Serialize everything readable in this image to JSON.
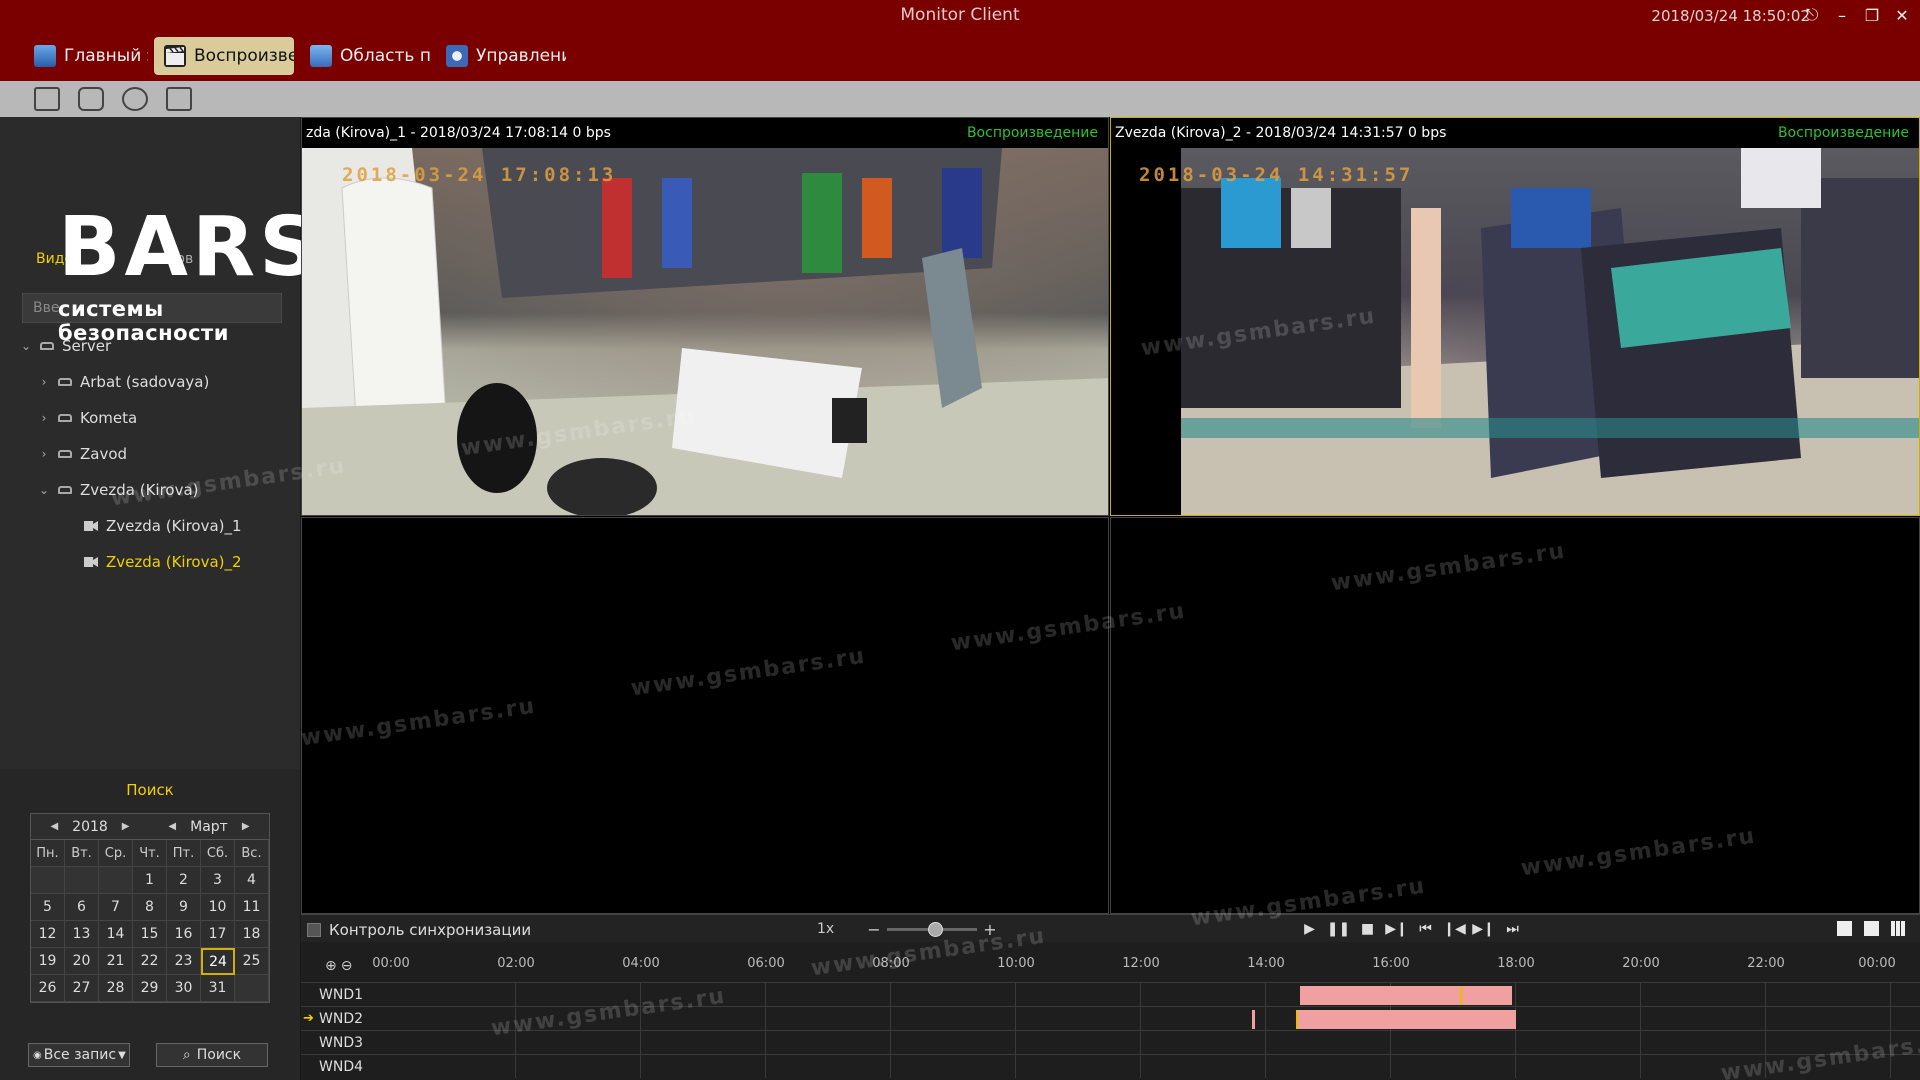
{
  "window": {
    "title": "Monitor Client",
    "clock": "2018/03/24 18:50:02"
  },
  "nav": {
    "tabs": [
      {
        "label": "Главный эк",
        "icon": "monitor-icon"
      },
      {
        "label": "Воспроизве",
        "icon": "clapper-icon"
      },
      {
        "label": "Область пр",
        "icon": "area-icon"
      },
      {
        "label": "Управлени",
        "icon": "control-icon"
      }
    ],
    "active": 1
  },
  "logo": {
    "brand": "BARS",
    "tagline": "системы безопасности"
  },
  "sidebar": {
    "tabs": {
      "video": "Видео",
      "list": "ок  ...ов"
    },
    "search_placeholder": "Вве",
    "tree": [
      {
        "label": "Server",
        "type": "server",
        "expanded": true
      },
      {
        "label": "Arbat (sadovaya)",
        "type": "group"
      },
      {
        "label": "Kometa",
        "type": "group"
      },
      {
        "label": "Zavod",
        "type": "group"
      },
      {
        "label": "Zvezda (Kirova)",
        "type": "group",
        "expanded": true
      },
      {
        "label": "Zvezda (Kirova)_1",
        "type": "camera"
      },
      {
        "label": "Zvezda (Kirova)_2",
        "type": "camera",
        "selected": true
      }
    ]
  },
  "search_panel": {
    "title": "Поиск",
    "year": "2018",
    "month": "Март",
    "weekdays": [
      "Пн.",
      "Вт.",
      "Ср.",
      "Чт.",
      "Пт.",
      "Сб.",
      "Вс."
    ],
    "days": [
      "",
      "",
      "",
      "1",
      "2",
      "3",
      "4",
      "5",
      "6",
      "7",
      "8",
      "9",
      "10",
      "11",
      "12",
      "13",
      "14",
      "15",
      "16",
      "17",
      "18",
      "19",
      "20",
      "21",
      "22",
      "23",
      "24",
      "25",
      "26",
      "27",
      "28",
      "29",
      "30",
      "31",
      ""
    ],
    "selected_day": "24",
    "record_filter": "Все запис",
    "search_button": "Поиск"
  },
  "panes": [
    {
      "title": "zda (Kirova)_1 - 2018/03/24 17:08:14  0 bps",
      "status": "Воспроизведение",
      "stamp": "2018-03-24  17:08:13"
    },
    {
      "title": "Zvezda (Kirova)_2 - 2018/03/24 14:31:57  0 bps",
      "status": "Воспроизведение",
      "stamp": "2018-03-24  14:31:57",
      "active": true
    }
  ],
  "playback": {
    "sync_label": "Контроль синхронизации",
    "speed": "1x"
  },
  "timeline": {
    "labels": [
      "00:00",
      "02:00",
      "04:00",
      "06:00",
      "08:00",
      "10:00",
      "12:00",
      "14:00",
      "16:00",
      "18:00",
      "20:00",
      "22:00",
      "00:00"
    ],
    "rows": [
      "WND1",
      "WND2",
      "WND3",
      "WND4"
    ],
    "current_row": "WND2"
  },
  "watermark": "www.gsmbars.ru",
  "colors": {
    "titlebar": "#7a0000",
    "active_tab": "#d9cc9a",
    "highlight": "#f0d000",
    "status_green": "#2ec02e",
    "recording": "#f0a0a0"
  }
}
